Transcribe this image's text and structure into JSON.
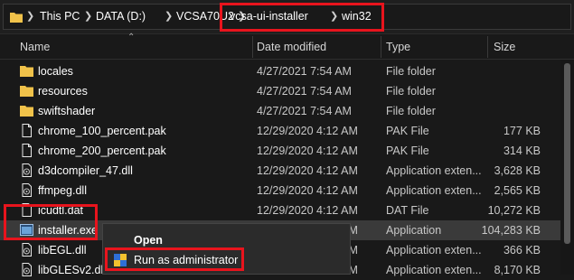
{
  "breadcrumb": [
    "This PC",
    "DATA (D:)",
    "VCSA70U2",
    "vcsa-ui-installer",
    "win32"
  ],
  "columns": {
    "name": "Name",
    "date": "Date modified",
    "type": "Type",
    "size": "Size"
  },
  "files": [
    {
      "icon": "folder-icon",
      "name": "locales",
      "date": "4/27/2021 7:54 AM",
      "type": "File folder",
      "size": ""
    },
    {
      "icon": "folder-icon",
      "name": "resources",
      "date": "4/27/2021 7:54 AM",
      "type": "File folder",
      "size": ""
    },
    {
      "icon": "folder-icon",
      "name": "swiftshader",
      "date": "4/27/2021 7:54 AM",
      "type": "File folder",
      "size": ""
    },
    {
      "icon": "file-icon",
      "name": "chrome_100_percent.pak",
      "date": "12/29/2020 4:12 AM",
      "type": "PAK File",
      "size": "177 KB"
    },
    {
      "icon": "file-icon",
      "name": "chrome_200_percent.pak",
      "date": "12/29/2020 4:12 AM",
      "type": "PAK File",
      "size": "314 KB"
    },
    {
      "icon": "dll-icon",
      "name": "d3dcompiler_47.dll",
      "date": "12/29/2020 4:12 AM",
      "type": "Application exten...",
      "size": "3,628 KB"
    },
    {
      "icon": "dll-icon",
      "name": "ffmpeg.dll",
      "date": "12/29/2020 4:12 AM",
      "type": "Application exten...",
      "size": "2,565 KB"
    },
    {
      "icon": "file-icon",
      "name": "icudtl.dat",
      "date": "12/29/2020 4:12 AM",
      "type": "DAT File",
      "size": "10,272 KB"
    },
    {
      "icon": "exe-icon",
      "name": "installer.exe",
      "date": "12/29/2020 4:12 AM",
      "type": "Application",
      "size": "104,283 KB"
    },
    {
      "icon": "dll-icon",
      "name": "libEGL.dll",
      "date": "12/29/2020 4:12 AM",
      "type": "Application exten...",
      "size": "366 KB"
    },
    {
      "icon": "dll-icon",
      "name": "libGLESv2.dll",
      "date": "12/29/2020 4:12 AM",
      "type": "Application exten...",
      "size": "8,170 KB"
    }
  ],
  "context_menu": {
    "open": "Open",
    "run_as_admin": "Run as administrator"
  },
  "colors": {
    "highlight": "#e8141d",
    "folder": "#f0c24a",
    "background": "#191919"
  }
}
